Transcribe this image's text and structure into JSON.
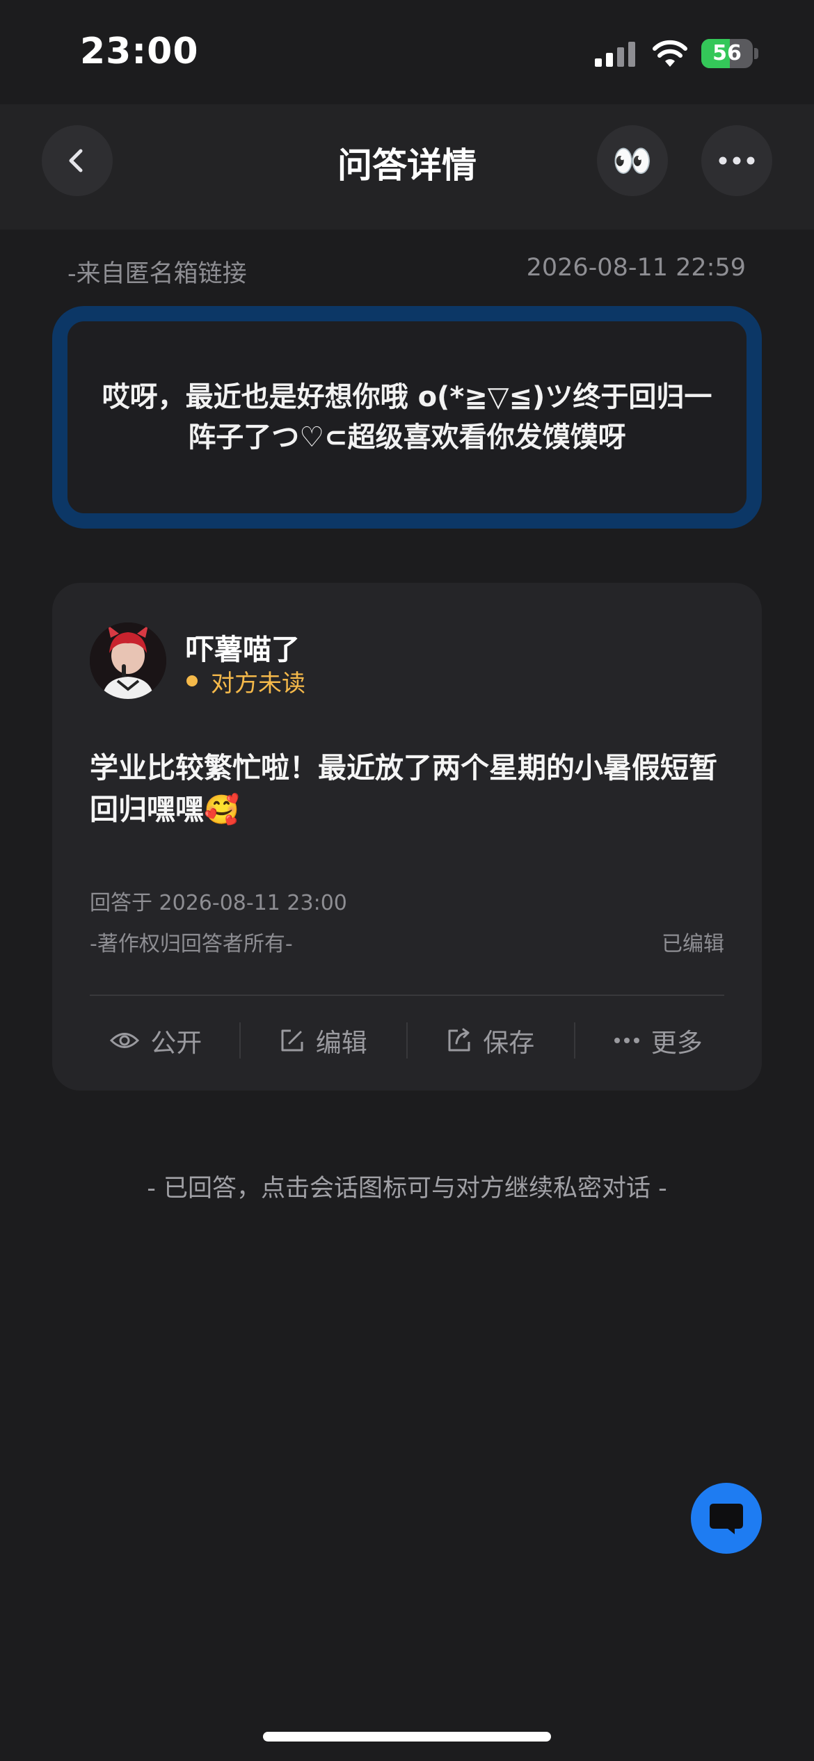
{
  "status_bar": {
    "time": "23:00",
    "battery_level": "56",
    "battery_fraction": 0.56,
    "battery_color": "#34c759"
  },
  "nav": {
    "title": "问答详情",
    "back_icon": "chevron-left-icon",
    "eyes_emoji": "👀",
    "more_icon": "ellipsis-icon"
  },
  "question": {
    "source": "-来自匿名箱链接",
    "date": "2026-08-11 22:59",
    "text": "哎呀，最近也是好想你哦 o(*≧▽≦)ツ终于回归一阵子了つ♡⊂超级喜欢看你发馍馍呀",
    "border_color": "#0c3766"
  },
  "answer": {
    "author": "吓薯喵了",
    "read_status": "对方未读",
    "status_color": "#f5b94a",
    "text": "学业比较繁忙啦！最近放了两个星期的小暑假短暂回归嘿嘿🥰",
    "answered_at": "回答于 2026-08-11 23:00",
    "copyright": "-著作权归回答者所有-",
    "edited": "已编辑",
    "actions": [
      {
        "label": "公开",
        "icon": "eye-icon"
      },
      {
        "label": "编辑",
        "icon": "edit-icon"
      },
      {
        "label": "保存",
        "icon": "share-icon"
      },
      {
        "label": "更多",
        "icon": "ellipsis-icon"
      }
    ]
  },
  "footer_note": "- 已回答，点击会话图标可与对方继续私密对话 -",
  "chat_button": {
    "icon": "chat-bubble-icon",
    "color": "#1e7cf2"
  }
}
